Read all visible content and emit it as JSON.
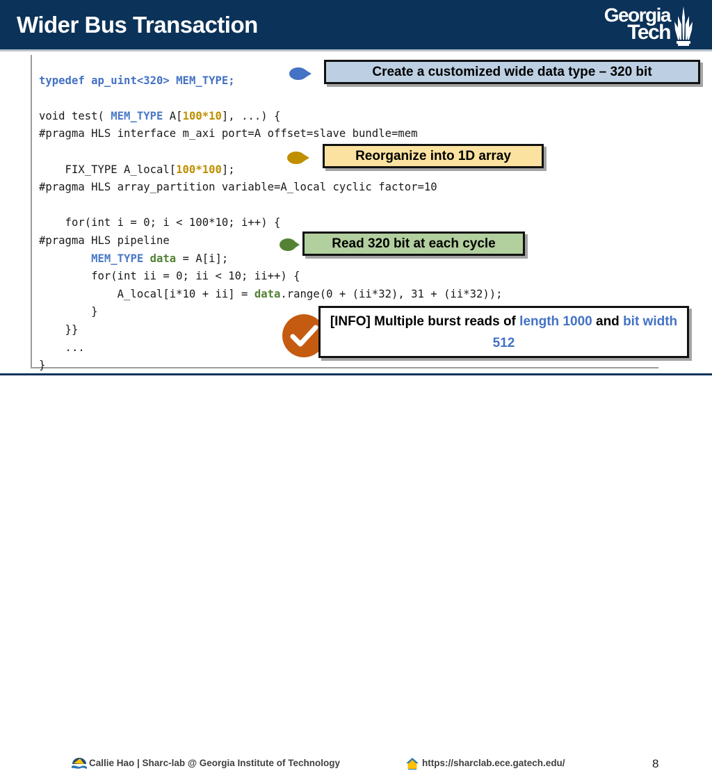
{
  "header": {
    "title": "Wider Bus Transaction",
    "logo": {
      "line1": "Georgia",
      "line2": "Tech",
      "icon": "georgia-tech-tower-icon"
    },
    "bg_color": "#0b3258"
  },
  "code": {
    "lines": [
      {
        "tokens": [
          {
            "t": "typedef ",
            "c": "kw"
          },
          {
            "t": "ap_uint<320> ",
            "c": "kw"
          },
          {
            "t": "MEM_TYPE;",
            "c": "kw"
          }
        ]
      },
      {
        "tokens": []
      },
      {
        "tokens": [
          {
            "t": "void test( ",
            "c": ""
          },
          {
            "t": "MEM_TYPE",
            "c": "typ"
          },
          {
            "t": " A[",
            "c": ""
          },
          {
            "t": "100*10",
            "c": "num"
          },
          {
            "t": "], ...) {",
            "c": ""
          }
        ]
      },
      {
        "tokens": [
          {
            "t": "#pragma HLS interface m_axi port=A offset=slave bundle=mem",
            "c": ""
          }
        ]
      },
      {
        "tokens": []
      },
      {
        "tokens": [
          {
            "t": "    FIX_TYPE A_local[",
            "c": ""
          },
          {
            "t": "100*100",
            "c": "num"
          },
          {
            "t": "];",
            "c": ""
          }
        ]
      },
      {
        "tokens": [
          {
            "t": "#pragma HLS array_partition variable=A_local cyclic factor=10",
            "c": ""
          }
        ]
      },
      {
        "tokens": []
      },
      {
        "tokens": [
          {
            "t": "    for(int i = 0; i < 100*10; i++) {",
            "c": ""
          }
        ]
      },
      {
        "tokens": [
          {
            "t": "#pragma HLS pipeline",
            "c": ""
          }
        ]
      },
      {
        "tokens": [
          {
            "t": "        ",
            "c": ""
          },
          {
            "t": "MEM_TYPE",
            "c": "typ"
          },
          {
            "t": " ",
            "c": ""
          },
          {
            "t": "data",
            "c": "var"
          },
          {
            "t": " = A[i];",
            "c": ""
          }
        ]
      },
      {
        "tokens": [
          {
            "t": "        for(int ii = 0; ii < 10; ii++) {",
            "c": ""
          }
        ]
      },
      {
        "tokens": [
          {
            "t": "            A_local[i*10 + ii] = ",
            "c": ""
          },
          {
            "t": "data",
            "c": "var"
          },
          {
            "t": ".range(0 + (ii*32), 31 + (ii*32));",
            "c": ""
          }
        ]
      },
      {
        "tokens": [
          {
            "t": "        }",
            "c": ""
          }
        ]
      },
      {
        "tokens": [
          {
            "t": "    }}",
            "c": ""
          }
        ]
      },
      {
        "tokens": [
          {
            "t": "    ...",
            "c": ""
          }
        ]
      },
      {
        "tokens": [
          {
            "t": "}",
            "c": ""
          }
        ]
      }
    ]
  },
  "callouts": [
    {
      "id": "callout-1",
      "label": "Create a customized wide data type – 320 bit",
      "bg": "#bdd0e3",
      "hand_icon": "pointing-hand-icon",
      "hand_color": "#4472c4"
    },
    {
      "id": "callout-2",
      "label": "Reorganize into 1D array",
      "bg": "#fbe2a0",
      "hand_icon": "pointing-hand-icon",
      "hand_color": "#bf8f00"
    },
    {
      "id": "callout-3",
      "label": "Read 320 bit at each cycle",
      "bg": "#b2cf9e",
      "hand_icon": "pointing-hand-icon",
      "hand_color": "#548235"
    }
  ],
  "info_box": {
    "icon": "check-circle-icon",
    "icon_color": "#c55a11",
    "part1": "[INFO] Multiple burst reads of ",
    "hl1": "length 1000",
    "part2": " and ",
    "hl2": "bit width 512",
    "highlight_color": "#4472c4"
  },
  "footer": {
    "author": "Callie Hao | Sharc-lab @ Georgia Institute of Technology",
    "author_icon": "sharc-lab-logo-icon",
    "url": "https://sharclab.ece.gatech.edu/",
    "url_icon": "home-icon",
    "page_number": "8"
  }
}
